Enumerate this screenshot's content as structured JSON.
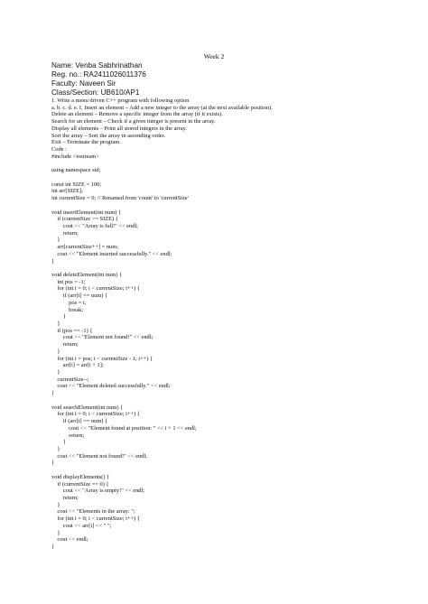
{
  "header": {
    "week": "Week 2"
  },
  "student": {
    "name": "Name: Venba Sabhrinathan",
    "reg_no": "Reg. no.: RA2411026011376",
    "faculty": "Faculty: Naveen Sir",
    "class_section": "Class/Section: UB610/AP1"
  },
  "content_lines": [
    "1. Write a menu driven C++ program with following option",
    "a. b. c. d. e. f. Insert an element – Add a new integer to the array (at the next available position).",
    "Delete an element – Remove a specific integer from the array (if it exists).",
    "Search for an element – Check if a given integer is present in the array.",
    "Display all elements – Print all stored integers in the array.",
    "Sort the array – Sort the array in ascending order.",
    "Exit – Terminate the program.",
    "Code :",
    "#include <iostream>",
    "",
    "using namespace std;",
    "",
    "const int SIZE = 100;",
    "int arr[SIZE];",
    "int currentSize = 0; // Renamed from 'count' to 'currentSize'",
    "",
    "void insertElement(int num) {",
    "    if (currentSize >= SIZE) {",
    "        cout << \"Array is full!\" << endl;",
    "        return;",
    "    }",
    "    arr[currentSize++] = num;",
    "    cout << \"Element inserted successfully.\" << endl;",
    "}",
    "",
    "void deleteElement(int num) {",
    "    int pos = -1;",
    "    for (int i = 0; i < currentSize; i++) {",
    "        if (arr[i] == num) {",
    "            pos = i;",
    "            break;",
    "        }",
    "    }",
    "    if (pos == -1) {",
    "        cout << \"Element not found!\" << endl;",
    "        return;",
    "    }",
    "    for (int i = pos; i < currentSize - 1; i++) {",
    "        arr[i] = arr[i + 1];",
    "    }",
    "    currentSize--;",
    "    cout << \"Element deleted successfully.\" << endl;",
    "}",
    "",
    "void searchElement(int num) {",
    "    for (int i = 0; i < currentSize; i++) {",
    "        if (arr[i] == num) {",
    "            cout << \"Element found at position: \" << i + 1 << endl;",
    "            return;",
    "        }",
    "    }",
    "    cout << \"Element not found!\" << endl;",
    "}",
    "",
    "void displayElements() {",
    "    if (currentSize == 0) {",
    "        cout << \"Array is empty!\" << endl;",
    "        return;",
    "    }",
    "    cout << \"Elements in the array: \";",
    "    for (int i = 0; i < currentSize; i++) {",
    "        cout << arr[i] << \" \";",
    "    }",
    "    cout << endl;",
    "}"
  ]
}
